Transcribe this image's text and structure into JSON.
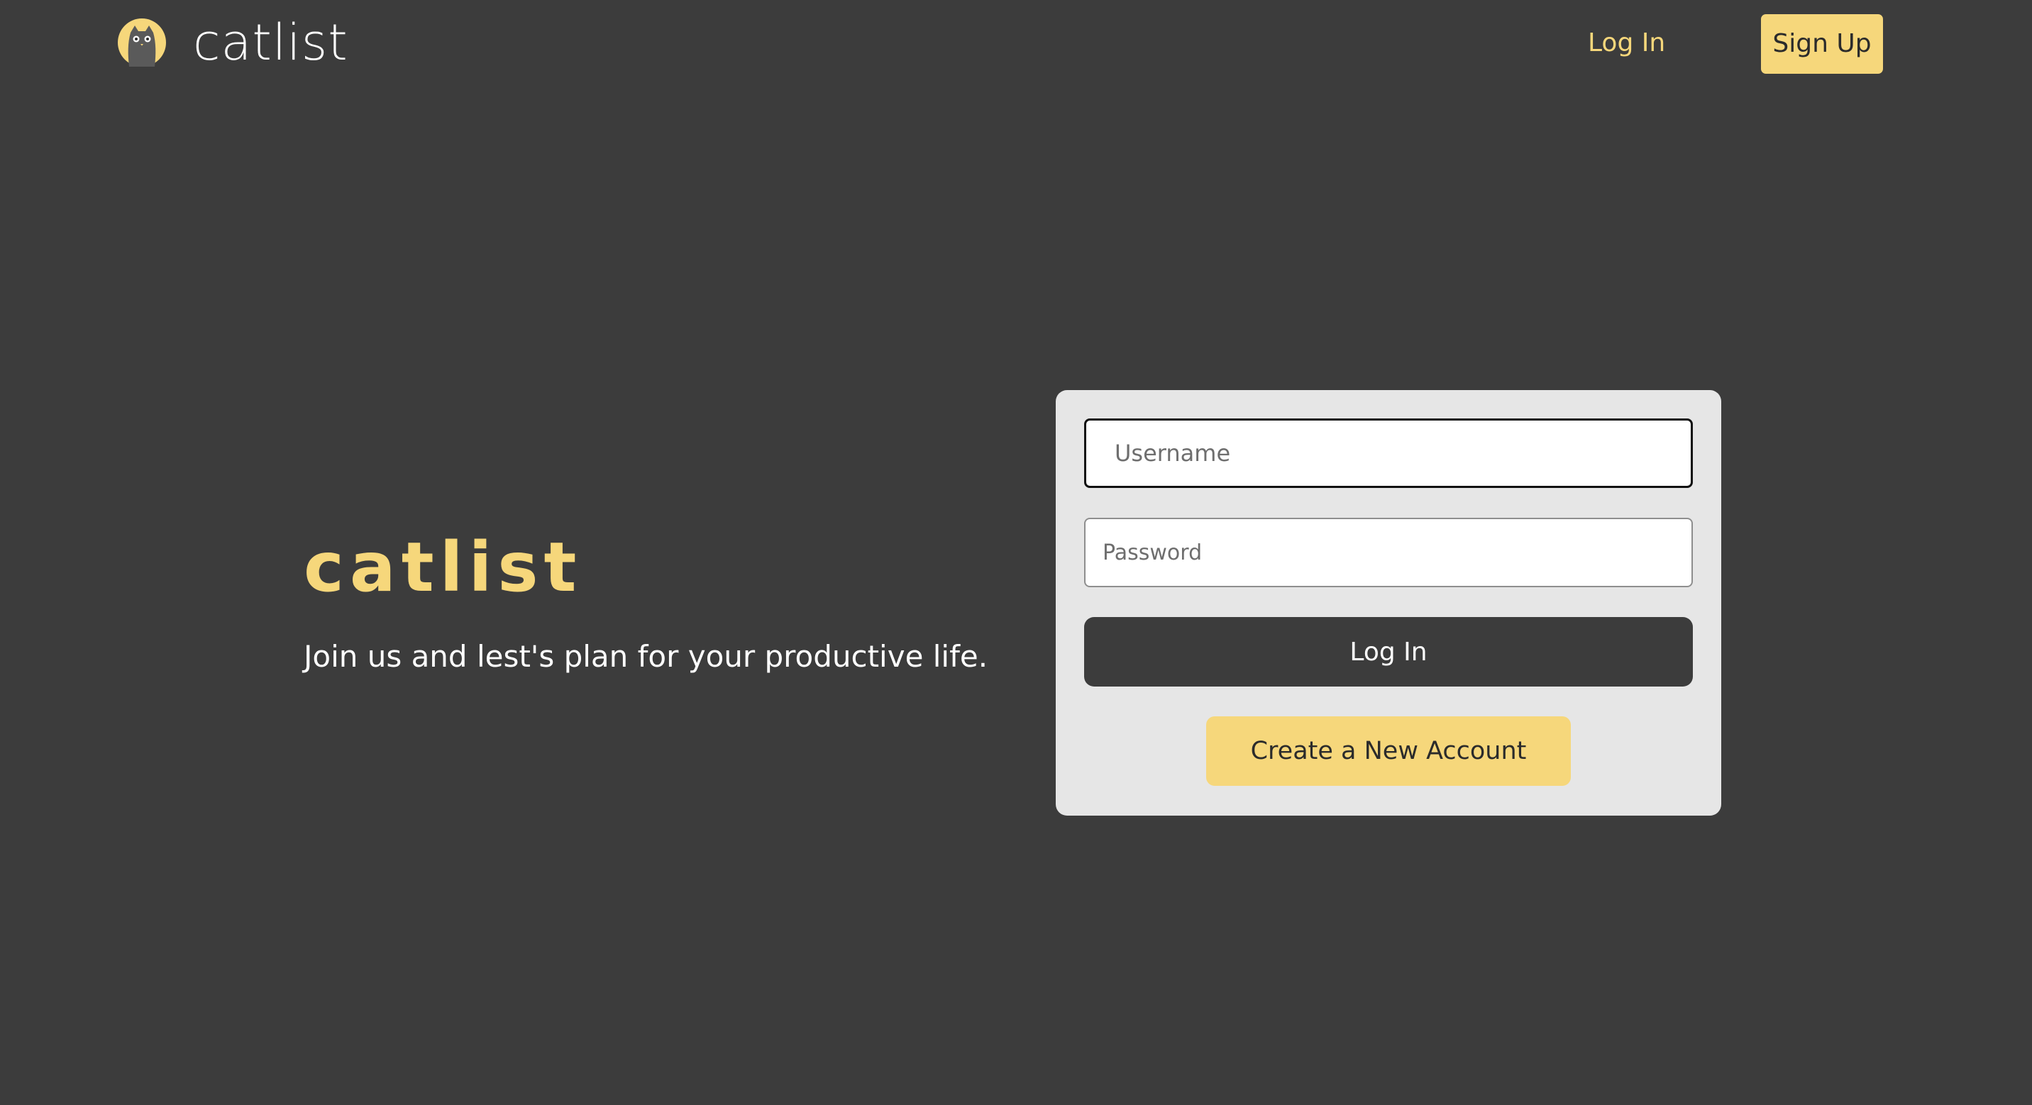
{
  "navbar": {
    "brand_name": "catlist",
    "login_label": "Log In",
    "signup_label": "Sign Up"
  },
  "hero": {
    "title": "catlist",
    "subtitle": "Join us and lest's plan for your productive life."
  },
  "login_form": {
    "username_placeholder": "Username",
    "username_value": "",
    "password_placeholder": "Password",
    "password_value": "",
    "login_button_label": "Log In",
    "create_account_label": "Create a New Account"
  },
  "colors": {
    "background": "#3c3c3c",
    "accent_yellow": "#f6d77b",
    "card_background": "#e6e6e6",
    "text_light": "#ffffff",
    "text_dark": "#2b2b2b"
  },
  "icons": {
    "brand_logo": "cat-logo-icon"
  }
}
